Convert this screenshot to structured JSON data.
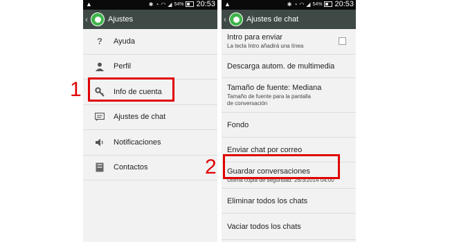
{
  "left_phone": {
    "status_time": "20:53",
    "battery": "54%",
    "title": "Ajustes",
    "items": [
      {
        "label": "Ayuda",
        "icon": "help-icon"
      },
      {
        "label": "Perfil",
        "icon": "profile-icon"
      },
      {
        "label": "Info de cuenta",
        "icon": "key-icon"
      },
      {
        "label": "Ajustes de chat",
        "icon": "chat-settings-icon"
      },
      {
        "label": "Notificaciones",
        "icon": "speaker-icon"
      },
      {
        "label": "Contactos",
        "icon": "contacts-icon"
      }
    ]
  },
  "right_phone": {
    "status_time": "20:53",
    "battery": "54%",
    "title": "Ajustes de chat",
    "items": [
      {
        "label": "Intro para enviar",
        "sub": "La tecla Intro añadirá una línea",
        "checkbox": true
      },
      {
        "label": "Descarga autom. de multimedia"
      },
      {
        "label": "Tamaño de fuente: Mediana",
        "sub": "Tamaño de fuente para la pantalla de conversación"
      },
      {
        "label": "Fondo"
      },
      {
        "label": "Enviar chat por correo"
      },
      {
        "label": "Guardar conversaciones",
        "sub": "Última copia de seguridad: 26/3/2014 04:00"
      },
      {
        "label": "Eliminar todos los chats"
      },
      {
        "label": "Vaciar todos los chats"
      }
    ]
  },
  "annotations": {
    "step1": "1",
    "step2": "2",
    "highlight_color": "#e00000"
  },
  "colors": {
    "action_bar": "#3f4a46",
    "status_bar": "#0a0a0a",
    "whatsapp_green": "#3fb44a",
    "list_bg": "#f2f2f2"
  }
}
